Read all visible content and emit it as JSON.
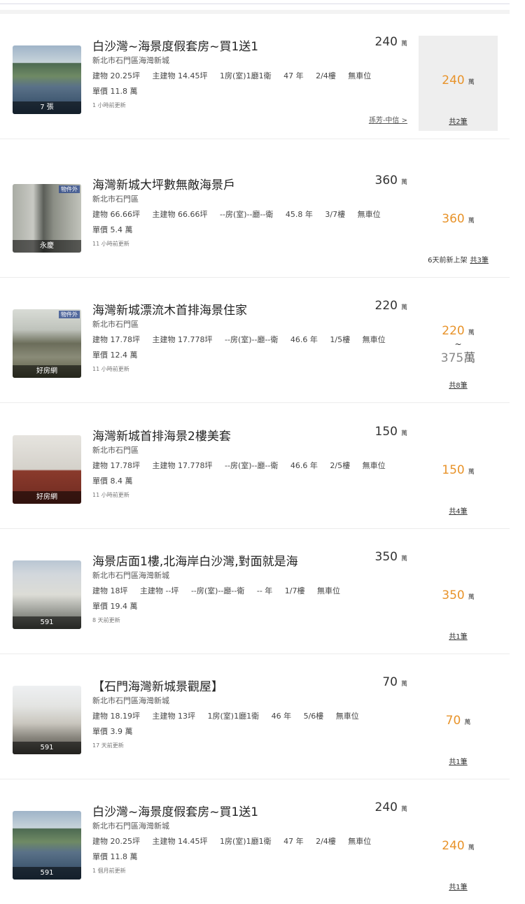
{
  "unit_word": "萬",
  "listings": [
    {
      "title": "白沙灣~海景度假套房~買1送1",
      "address": "新北市石門區海灣新城",
      "specs": [
        "建物 20.25坪",
        "主建物 14.45坪",
        "1房(室)1廳1衛",
        "47 年",
        "2/4樓",
        "無車位"
      ],
      "unit_price": "單價 11.8 萬",
      "updated": "1 小時前更新",
      "price": "240",
      "agent": "孫芳-中信 >",
      "thumb_label": "7 張",
      "side_price": "240",
      "side_count": "共2筆"
    },
    {
      "title": "海灣新城大坪數無敵海景戶",
      "address": "新北市石門區",
      "specs": [
        "建物 66.66坪",
        "主建物 66.66坪",
        "--房(室)--廳--衛",
        "45.8 年",
        "3/7樓",
        "無車位"
      ],
      "unit_price": "單價 5.4 萬",
      "updated": "11 小時前更新",
      "price": "360",
      "thumb_label": "永慶",
      "thumb_tag": "物件外",
      "side_price": "360",
      "side_new": "6天前新上架",
      "side_count": "共3筆"
    },
    {
      "title": "海灣新城漂流木首排海景住家",
      "address": "新北市石門區",
      "specs": [
        "建物 17.78坪",
        "主建物 17.778坪",
        "--房(室)--廳--衛",
        "46.6 年",
        "1/5樓",
        "無車位"
      ],
      "unit_price": "單價 12.4 萬",
      "updated": "11 小時前更新",
      "price": "220",
      "thumb_label": "好房網",
      "thumb_tag": "物件外",
      "side_price": "220",
      "side_tilde": "~",
      "side_price_high": "375",
      "side_count": "共8筆"
    },
    {
      "title": "海灣新城首排海景2樓美套",
      "address": "新北市石門區",
      "specs": [
        "建物 17.78坪",
        "主建物 17.778坪",
        "--房(室)--廳--衛",
        "46.6 年",
        "2/5樓",
        "無車位"
      ],
      "unit_price": "單價 8.4 萬",
      "updated": "11 小時前更新",
      "price": "150",
      "thumb_label": "好房網",
      "side_price": "150",
      "side_count": "共4筆"
    },
    {
      "title": "海景店面1樓,北海岸白沙灣,對面就是海",
      "address": "新北市石門區海灣新城",
      "specs": [
        "建物 18坪",
        "主建物 --坪",
        "--房(室)--廳--衛",
        "-- 年",
        "1/7樓",
        "無車位"
      ],
      "unit_price": "單價 19.4 萬",
      "updated": "8 天前更新",
      "price": "350",
      "thumb_label": "591",
      "side_price": "350",
      "side_count": "共1筆"
    },
    {
      "title": "【石門海灣新城景觀屋】",
      "address": "新北市石門區海灣新城",
      "specs": [
        "建物 18.19坪",
        "主建物 13坪",
        "1房(室)1廳1衛",
        "46 年",
        "5/6樓",
        "無車位"
      ],
      "unit_price": "單價 3.9 萬",
      "updated": "17 天前更新",
      "price": "70",
      "thumb_label": "591",
      "side_price": "70",
      "side_count": "共1筆"
    },
    {
      "title": "白沙灣~海景度假套房~買1送1",
      "address": "新北市石門區海灣新城",
      "specs": [
        "建物 20.25坪",
        "主建物 14.45坪",
        "1房(室)1廳1衛",
        "47 年",
        "2/4樓",
        "無車位"
      ],
      "unit_price": "單價 11.8 萬",
      "updated": "1 個月前更新",
      "price": "240",
      "thumb_label": "591",
      "side_price": "240",
      "side_count": "共1筆"
    }
  ]
}
